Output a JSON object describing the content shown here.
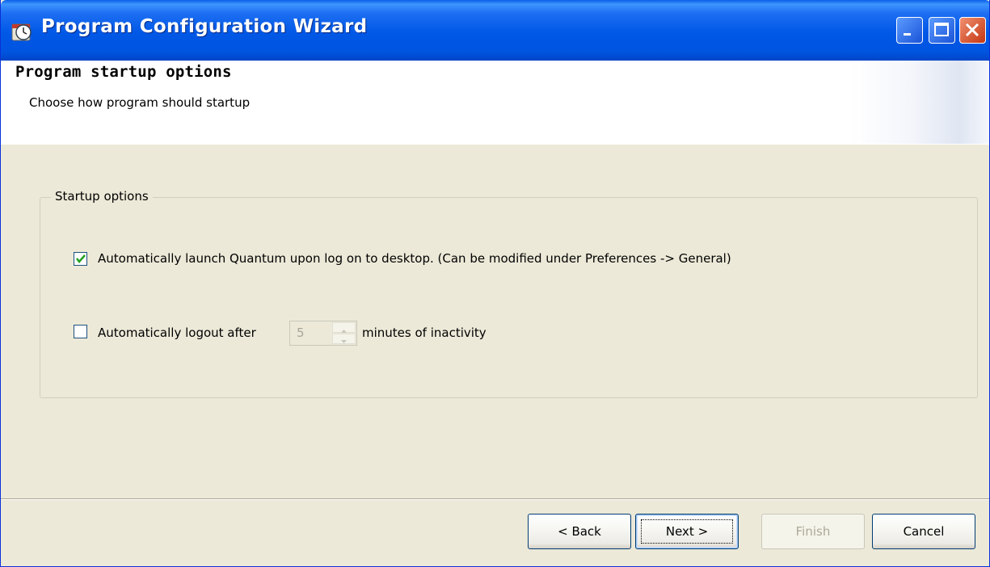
{
  "window": {
    "title": "Program Configuration Wizard",
    "controls": {
      "minimize_icon": "minimize-icon",
      "maximize_icon": "maximize-icon",
      "close_icon": "close-icon"
    }
  },
  "header": {
    "title": "Program startup options",
    "subtitle": "Choose how program should startup"
  },
  "group": {
    "legend": "Startup options",
    "options": [
      {
        "label": "Automatically launch Quantum upon log on to desktop. (Can be modified under Preferences -> General)",
        "checked": true
      },
      {
        "label_before": "Automatically logout after",
        "value": "5",
        "label_after": "minutes of inactivity",
        "checked": false
      }
    ]
  },
  "buttons": {
    "back": "< Back",
    "next": "Next >",
    "finish": "Finish",
    "cancel": "Cancel"
  },
  "colors": {
    "titlebar": "#0054e3",
    "window_bg": "#ece9d8",
    "header_bg": "#ffffff",
    "disabled_text": "#aca899"
  }
}
